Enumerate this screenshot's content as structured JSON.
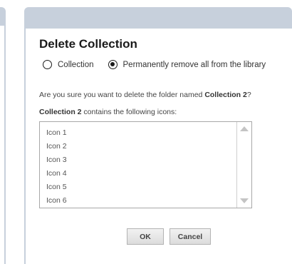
{
  "dialog": {
    "title": "Delete Collection",
    "options": [
      {
        "label": "Collection",
        "selected": false
      },
      {
        "label": "Permanently remove all from the library",
        "selected": true
      }
    ],
    "question_prefix": "Are you sure you want to delete the folder named ",
    "collection_name": "Collection 2",
    "question_suffix": "?",
    "contains_suffix": " contains the following icons:",
    "icons": [
      "Icon 1",
      "Icon 2",
      "Icon 3",
      "Icon 4",
      "Icon 5",
      "Icon 6"
    ],
    "ok_label": "OK",
    "cancel_label": "Cancel"
  },
  "colors": {
    "titlebar": "#c7d0dc",
    "button_border": "#b3b3b3"
  }
}
